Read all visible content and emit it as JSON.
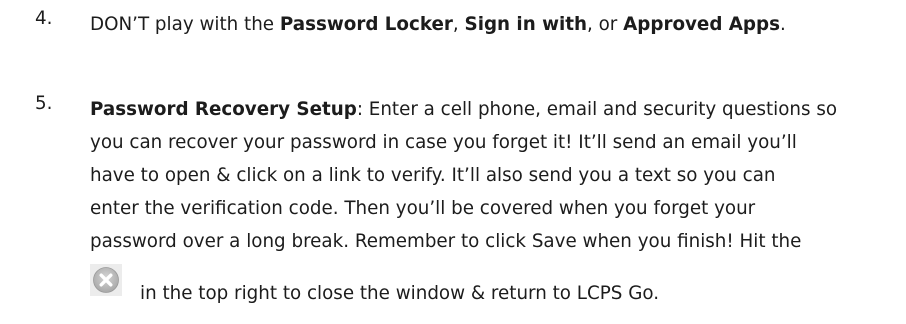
{
  "items": [
    {
      "number": "4.",
      "parts": {
        "p1": "DON’T play with the ",
        "b1": "Password Locker",
        "p2": ", ",
        "b2": "Sign in with",
        "p3": ", or ",
        "b3": "Approved Apps",
        "p4": "."
      }
    },
    {
      "number": "5.",
      "heading": "Password Recovery Setup",
      "lines": [
        ": Enter a cell phone, email and security questions so",
        "you can recover your password in case you forget it! It’ll send an email you’ll",
        "have to open & click on a link to verify. It’ll also send you a text so you can",
        "enter the verification code. Then you’ll be covered when you forget your",
        "password over a long break. Remember to click Save when you finish! Hit the"
      ],
      "after_icon": "in the top right to close the window & return to LCPS Go.",
      "icon": "close-circle-icon"
    }
  ],
  "colors": {
    "text": "#1c1c1c",
    "icon_fill": "#b9b9b9",
    "icon_mark": "#ffffff"
  }
}
